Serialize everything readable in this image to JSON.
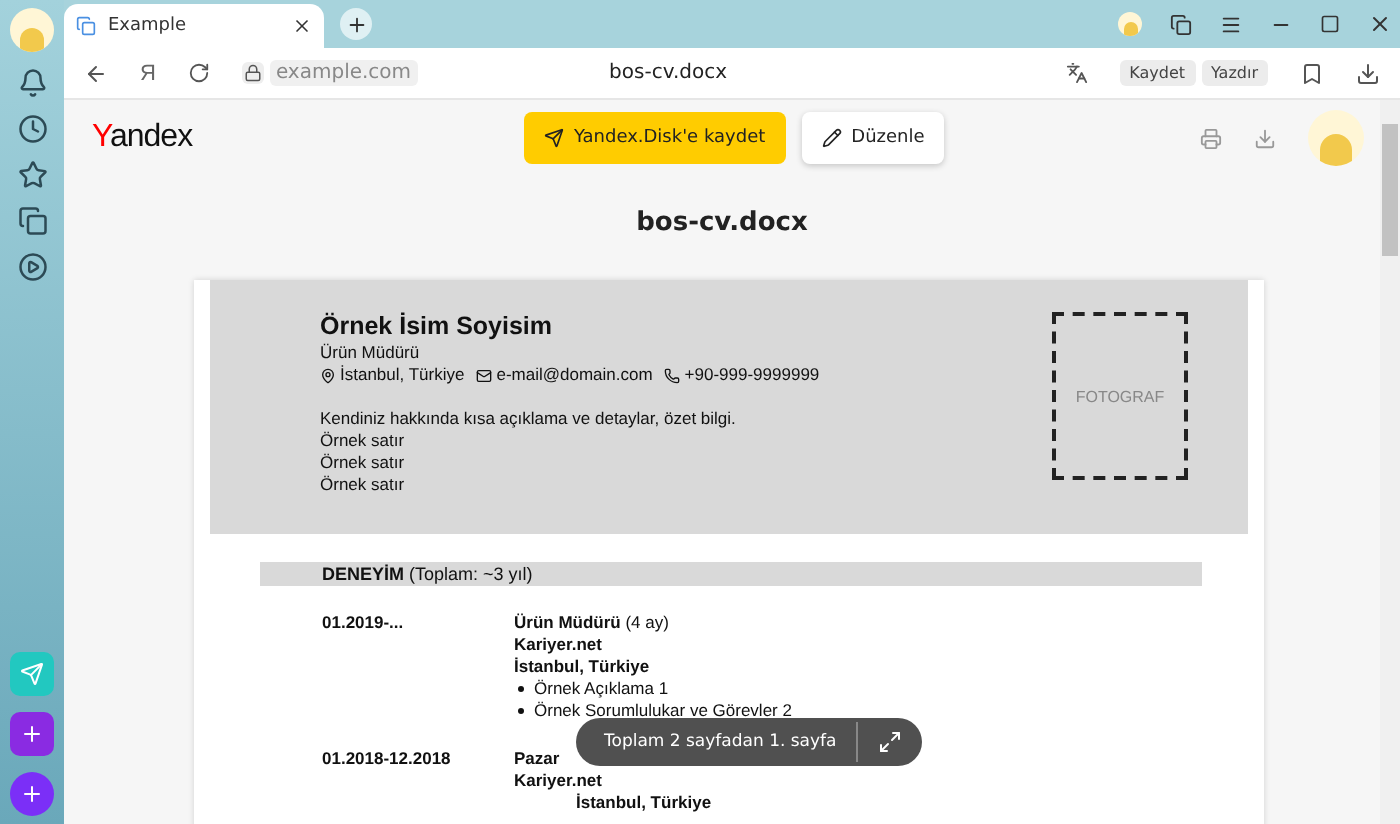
{
  "browser": {
    "tab": {
      "title": "Example",
      "selected": true
    },
    "address": "example.com",
    "page_title": "bos-cv.docx",
    "yandex_key": "Я",
    "actions": [
      "Kaydet",
      "Yazdır"
    ]
  },
  "toolbar": {
    "logo": "Yandex",
    "save_button": "Yandex.Disk'e kaydet",
    "edit_button": "Düzenle"
  },
  "document": {
    "title": "bos-cv.docx",
    "header": {
      "name": "Örnek İsim Soyisim",
      "role": "Ürün Müdürü",
      "contacts": [
        {
          "kind": "location",
          "text": "İstanbul, Türkiye"
        },
        {
          "kind": "email",
          "text": "e-mail@domain.com"
        },
        {
          "kind": "phone",
          "text": "+90-999-9999999"
        }
      ],
      "summary": "Kendiniz hakkında kısa açıklama ve detaylar, özet bilgi.",
      "lines": [
        "Örnek satır",
        "Örnek satır",
        "Örnek satır"
      ],
      "photo": "FOTOGRAF"
    },
    "section": {
      "heading": "**DENEYİM** (Toplam: ~3 yıl)",
      "jobs": [
        {
          "date": "01.2019-...",
          "title": "**Ürün Müdürü** (4 ay)",
          "company": "Kariyer.net",
          "location": "İstanbul, Türkiye",
          "bullets": [
            "Örnek Açıklama 1",
            "Örnek Sorumlulukar ve Görevler 2"
          ]
        },
        {
          "date": "01.2018-12.2018",
          "title": "**Pazar**",
          "company": "Kariyer.net",
          "location": "İstanbul, Türkiye"
        }
      ]
    }
  },
  "page_indicator": "Toplam 2 sayfadan 1. sayfa"
}
